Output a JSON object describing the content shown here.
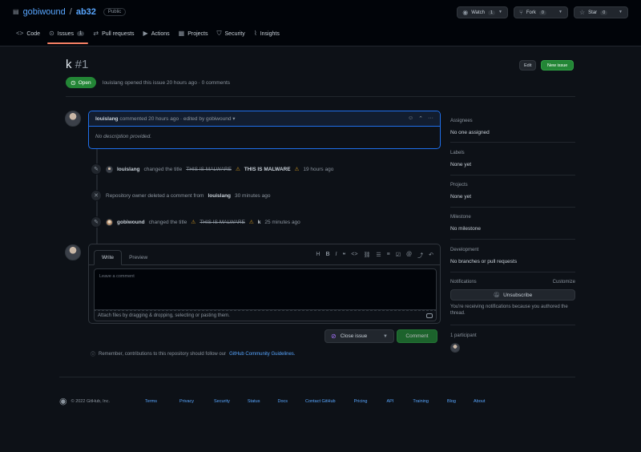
{
  "repo": {
    "owner": "gobiwound",
    "separator": "/",
    "name": "ab32",
    "visibility": "Public"
  },
  "repo_actions": {
    "watch": {
      "label": "Watch",
      "count": "1"
    },
    "fork": {
      "label": "Fork",
      "count": "0"
    },
    "star": {
      "label": "Star",
      "count": "0"
    }
  },
  "tabs": [
    {
      "label": "Code",
      "icon": "code-icon"
    },
    {
      "label": "Issues",
      "icon": "issue-icon",
      "count": "1"
    },
    {
      "label": "Pull requests",
      "icon": "pr-icon"
    },
    {
      "label": "Actions",
      "icon": "play-icon"
    },
    {
      "label": "Projects",
      "icon": "table-icon"
    },
    {
      "label": "Security",
      "icon": "shield-icon"
    },
    {
      "label": "Insights",
      "icon": "graph-icon"
    }
  ],
  "issue": {
    "title": "k",
    "number": "#1",
    "state": "Open",
    "meta": {
      "author": "louislang",
      "text": "opened this issue 20 hours ago · 0 comments"
    },
    "edit_label": "Edit",
    "new_label": "New issue"
  },
  "comment": {
    "author": "louislang",
    "head_text": "commented 20 hours ago · edited by gobiwound",
    "caret": "▾",
    "body": "No description provided."
  },
  "timeline": [
    {
      "actor": "louislang",
      "verb": "changed the title",
      "old": "THIS IS MALWARE",
      "new": "THIS IS MALWARE",
      "time": "19 hours ago"
    },
    {
      "prefix": "Repository owner deleted a comment from",
      "actor": "louislang",
      "time": "30 minutes ago"
    },
    {
      "actor": "gobiwound",
      "verb": "changed the title",
      "old": "THIS IS MALWARE",
      "new": "k",
      "time": "25 minutes ago"
    }
  ],
  "form": {
    "write_tab": "Write",
    "preview_tab": "Preview",
    "placeholder": "Leave a comment",
    "attach_text": "Attach files by dragging & dropping, selecting or pasting them.",
    "close_label": "Close issue",
    "comment_label": "Comment",
    "remember_text": "Remember, contributions to this repository should follow our",
    "remember_link": "GitHub Community Guidelines."
  },
  "sidebar": {
    "assignees": {
      "label": "Assignees",
      "value": "No one assigned"
    },
    "labels": {
      "label": "Labels",
      "value": "None yet"
    },
    "projects": {
      "label": "Projects",
      "value": "None yet"
    },
    "milestone": {
      "label": "Milestone",
      "value": "No milestone"
    },
    "development": {
      "label": "Development",
      "value": "No branches or pull requests"
    },
    "notifications": {
      "label": "Notifications",
      "customize": "Customize",
      "button": "Unsubscribe",
      "text": "You're receiving notifications because you authored the thread."
    },
    "participants": {
      "label": "1 participant"
    }
  },
  "footer": {
    "copyright": "© 2022 GitHub, Inc.",
    "links": [
      "Terms",
      "Privacy",
      "Security",
      "Status",
      "Docs",
      "Contact GitHub",
      "Pricing",
      "API",
      "Training",
      "Blog",
      "About"
    ]
  },
  "colors": {
    "accent": "#58a6ff",
    "open": "#238636",
    "bg": "#0d1117",
    "tab_underline": "#f78166"
  }
}
